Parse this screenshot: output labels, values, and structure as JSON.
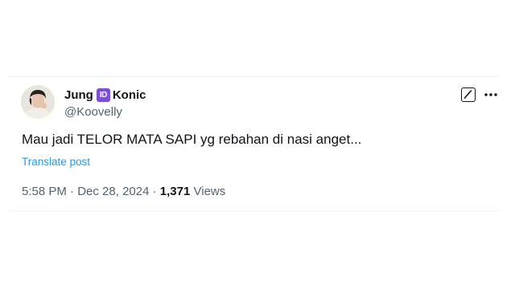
{
  "tweet": {
    "author": {
      "name_first": "Jung",
      "badge": "ID",
      "name_last": "Konic",
      "handle": "@Koovelly"
    },
    "icons": {
      "grok": "grok-icon",
      "more": "more-horizontal-icon"
    },
    "text": "Mau jadi TELOR MATA SAPI yg rebahan di nasi anget...",
    "translate_label": "Translate post",
    "time": "5:58 PM",
    "separator": "·",
    "date": "Dec 28, 2024",
    "views_count": "1,371",
    "views_label": "Views"
  },
  "colors": {
    "text_primary": "#0f1419",
    "text_secondary": "#536471",
    "link": "#1d9bf0",
    "badge": "#7b4fd6"
  }
}
